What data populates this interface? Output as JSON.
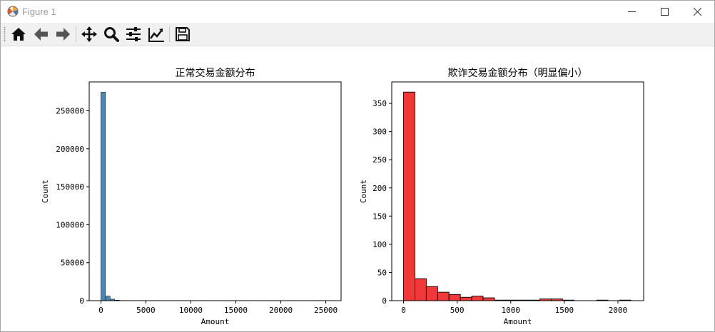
{
  "window": {
    "title": "Figure 1",
    "controls": {
      "minimize": "minimize",
      "maximize": "maximize",
      "close": "close"
    }
  },
  "toolbar": {
    "buttons": [
      {
        "id": "home",
        "icon": "home-icon"
      },
      {
        "id": "back",
        "icon": "arrow-left-icon"
      },
      {
        "id": "forward",
        "icon": "arrow-right-icon"
      },
      {
        "id": "pan",
        "icon": "move-icon"
      },
      {
        "id": "zoom",
        "icon": "magnifier-icon"
      },
      {
        "id": "subplots",
        "icon": "sliders-icon"
      },
      {
        "id": "edit-axis",
        "icon": "line-chart-icon"
      },
      {
        "id": "save",
        "icon": "floppy-disk-icon"
      }
    ]
  },
  "chart_data": [
    {
      "type": "bar",
      "title": "正常交易金额分布",
      "xlabel": "Amount",
      "ylabel": "Count",
      "xlim": [
        -1300,
        26700
      ],
      "ylim": [
        0,
        288000
      ],
      "xticks": [
        0,
        5000,
        10000,
        15000,
        20000,
        25000
      ],
      "yticks": [
        0,
        50000,
        100000,
        150000,
        200000,
        250000
      ],
      "bin_edges": [
        0,
        512,
        1024,
        1536,
        2048,
        2560,
        3072,
        3584,
        4096,
        4608,
        5120,
        5632,
        6144,
        6656,
        7168
      ],
      "counts": [
        274500,
        6000,
        2000,
        700,
        300,
        150,
        80,
        50,
        30,
        20,
        15,
        10,
        8,
        5
      ],
      "grid": false,
      "color": "#4c86b5"
    },
    {
      "type": "bar",
      "title": "欺诈交易金额分布（明显偏小）",
      "xlabel": "Amount",
      "ylabel": "Count",
      "xlim": [
        -110,
        2240
      ],
      "ylim": [
        0,
        388
      ],
      "xticks": [
        0,
        500,
        1000,
        1500,
        2000
      ],
      "yticks": [
        0,
        50,
        100,
        150,
        200,
        250,
        300,
        350
      ],
      "bin_edges": [
        0,
        106,
        212,
        318,
        424,
        530,
        636,
        742,
        848,
        954,
        1060,
        1166,
        1272,
        1378,
        1484,
        1590,
        1696,
        1802,
        1908,
        2014,
        2120
      ],
      "counts": [
        370,
        39,
        25,
        15,
        11,
        6,
        8,
        5,
        1,
        1,
        1,
        1,
        3,
        3,
        1,
        0,
        0,
        1,
        0,
        1
      ],
      "grid": false,
      "color": "#f03838"
    }
  ]
}
